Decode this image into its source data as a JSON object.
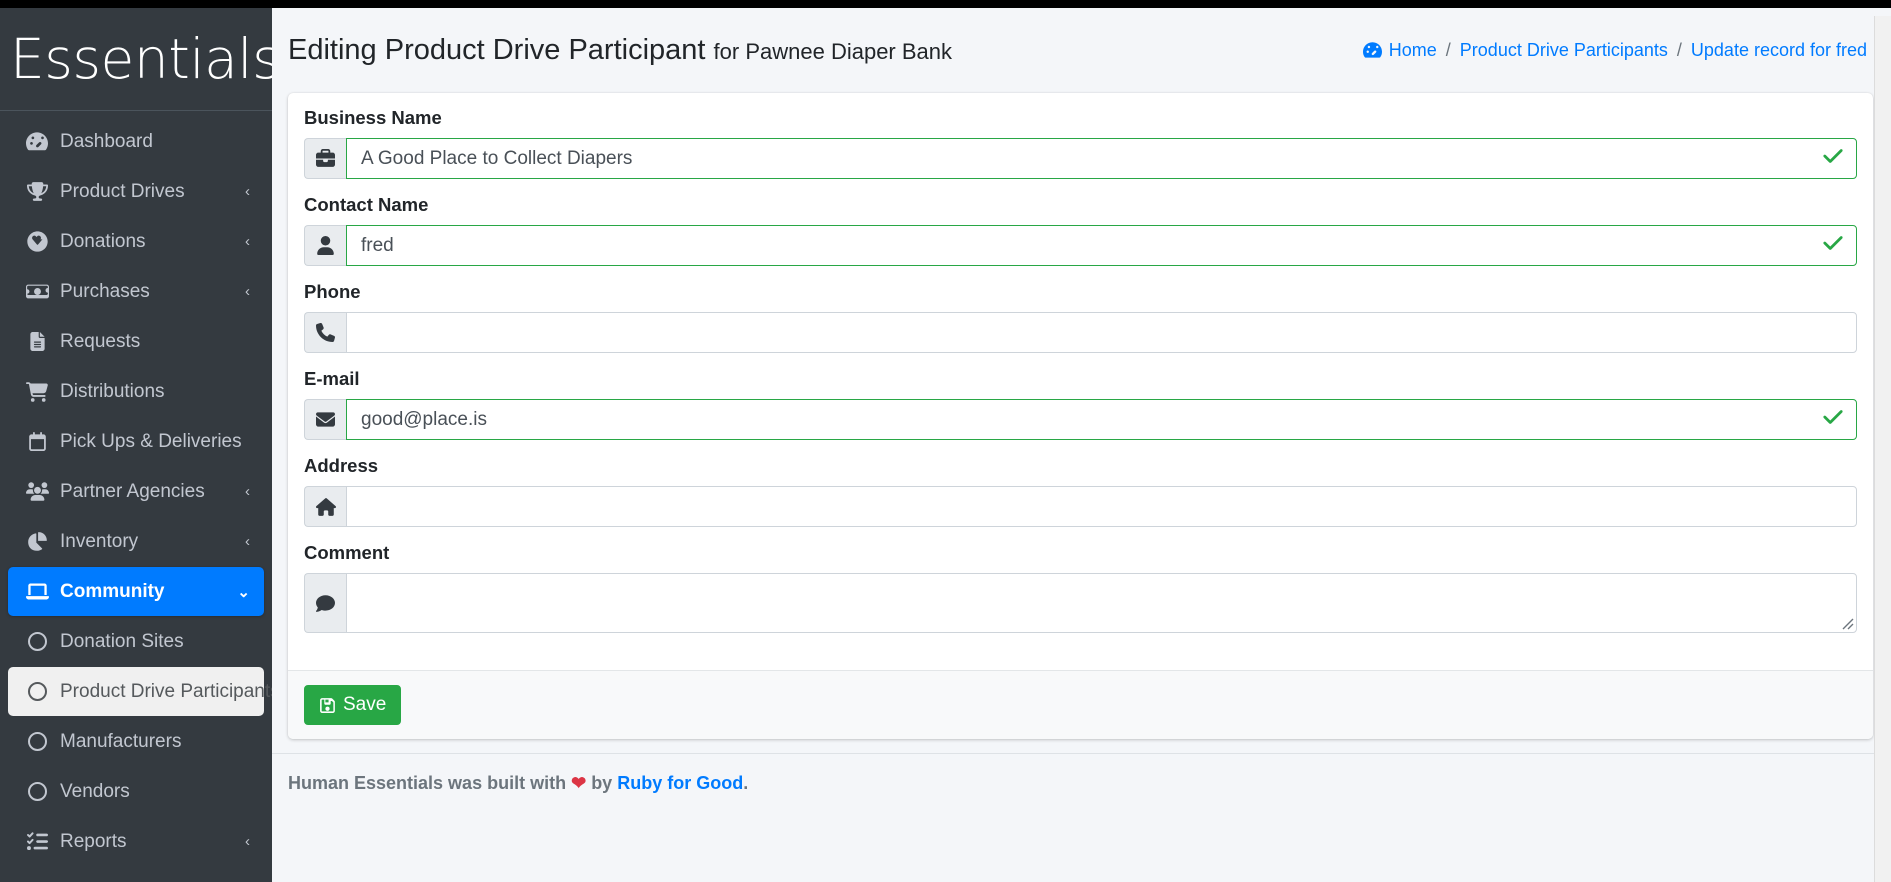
{
  "brand": {
    "name": "Essentials"
  },
  "sidebar": {
    "items": [
      {
        "label": "Dashboard",
        "icon": "gauge-icon",
        "arrow": "",
        "state": "normal"
      },
      {
        "label": "Product Drives",
        "icon": "trophy-icon",
        "arrow": "‹",
        "state": "normal"
      },
      {
        "label": "Donations",
        "icon": "heart-circle-icon",
        "arrow": "‹",
        "state": "normal"
      },
      {
        "label": "Purchases",
        "icon": "money-bill-icon",
        "arrow": "‹",
        "state": "normal"
      },
      {
        "label": "Requests",
        "icon": "file-lines-icon",
        "arrow": "",
        "state": "normal"
      },
      {
        "label": "Distributions",
        "icon": "shopping-cart-icon",
        "arrow": "",
        "state": "normal"
      },
      {
        "label": "Pick Ups & Deliveries",
        "icon": "calendar-icon",
        "arrow": "",
        "state": "normal"
      },
      {
        "label": "Partner Agencies",
        "icon": "users-icon",
        "arrow": "‹",
        "state": "normal"
      },
      {
        "label": "Inventory",
        "icon": "pie-chart-icon",
        "arrow": "‹",
        "state": "normal"
      },
      {
        "label": "Community",
        "icon": "laptop-icon",
        "arrow": "⌄",
        "state": "active"
      }
    ],
    "sub_items": [
      {
        "label": "Donation Sites",
        "icon": "circle-icon",
        "state": "normal"
      },
      {
        "label": "Product Drive Participants",
        "icon": "circle-icon",
        "state": "hovered"
      },
      {
        "label": "Manufacturers",
        "icon": "circle-icon",
        "state": "normal"
      },
      {
        "label": "Vendors",
        "icon": "circle-icon",
        "state": "normal"
      }
    ],
    "items_after": [
      {
        "label": "Reports",
        "icon": "list-check-icon",
        "arrow": "‹",
        "state": "normal"
      }
    ]
  },
  "header": {
    "title_strong": "Editing Product Drive Participant",
    "title_sub": "for Pawnee Diaper Bank",
    "breadcrumb": {
      "home_icon": "gauge-icon",
      "items": [
        "Home",
        "Product Drive Participants",
        "Update record for fred"
      ],
      "separator": "/"
    }
  },
  "form": {
    "fields": [
      {
        "label": "Business Name",
        "icon": "briefcase-icon",
        "value": "A Good Place to Collect Diapers",
        "placeholder": "",
        "valid": true,
        "type": "text",
        "name": "business-name"
      },
      {
        "label": "Contact Name",
        "icon": "user-icon",
        "value": "fred",
        "placeholder": "",
        "valid": true,
        "type": "text",
        "name": "contact-name"
      },
      {
        "label": "Phone",
        "icon": "phone-icon",
        "value": "",
        "placeholder": "",
        "valid": false,
        "type": "text",
        "name": "phone"
      },
      {
        "label": "E-mail",
        "icon": "envelope-icon",
        "value": "good@place.is",
        "placeholder": "",
        "valid": true,
        "type": "text",
        "name": "email"
      },
      {
        "label": "Address",
        "icon": "home-icon",
        "value": "",
        "placeholder": "",
        "valid": false,
        "type": "text",
        "name": "address"
      },
      {
        "label": "Comment",
        "icon": "comment-icon",
        "value": "",
        "placeholder": "",
        "valid": false,
        "type": "textarea",
        "name": "comment"
      }
    ],
    "save_label": "Save",
    "save_icon": "floppy-disk-icon"
  },
  "footer": {
    "prefix": "Human Essentials was built with",
    "heart": "❤",
    "middle": "by",
    "link": "Ruby for Good",
    "suffix": "."
  },
  "colors": {
    "sidebar_bg": "#343a40",
    "accent": "#007bff",
    "valid_green": "#28a745",
    "save_green": "#28a745",
    "heart_red": "#dc3545",
    "page_bg": "#f4f6f9"
  }
}
